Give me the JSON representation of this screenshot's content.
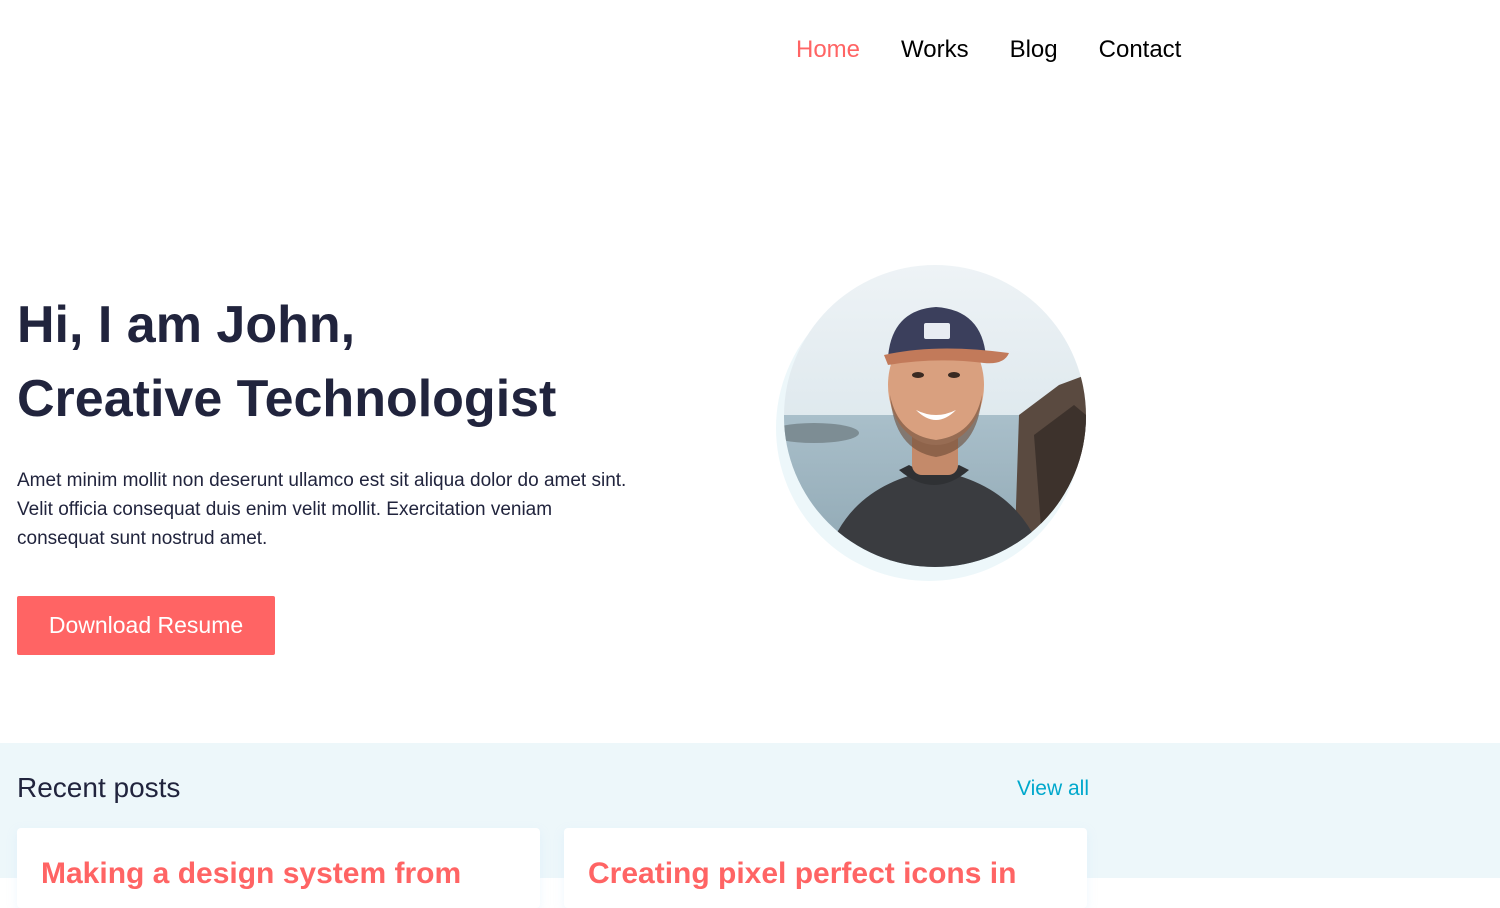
{
  "nav": {
    "items": [
      {
        "label": "Home",
        "active": true
      },
      {
        "label": "Works",
        "active": false
      },
      {
        "label": "Blog",
        "active": false
      },
      {
        "label": "Contact",
        "active": false
      }
    ]
  },
  "hero": {
    "title_line1": "Hi, I am John,",
    "title_line2": "Creative Technologist",
    "description": "Amet minim mollit non deserunt ullamco est sit aliqua dolor do amet sint. Velit officia consequat duis enim velit mollit. Exercitation veniam consequat sunt nostrud amet.",
    "cta_label": "Download Resume"
  },
  "posts": {
    "heading": "Recent posts",
    "view_all_label": "View all",
    "items": [
      {
        "title": "Making a design system from"
      },
      {
        "title": "Creating pixel perfect icons in"
      }
    ]
  },
  "colors": {
    "accent": "#ff6464",
    "heading": "#21243d",
    "link": "#00a8cc",
    "section_bg": "#edf7fa"
  }
}
